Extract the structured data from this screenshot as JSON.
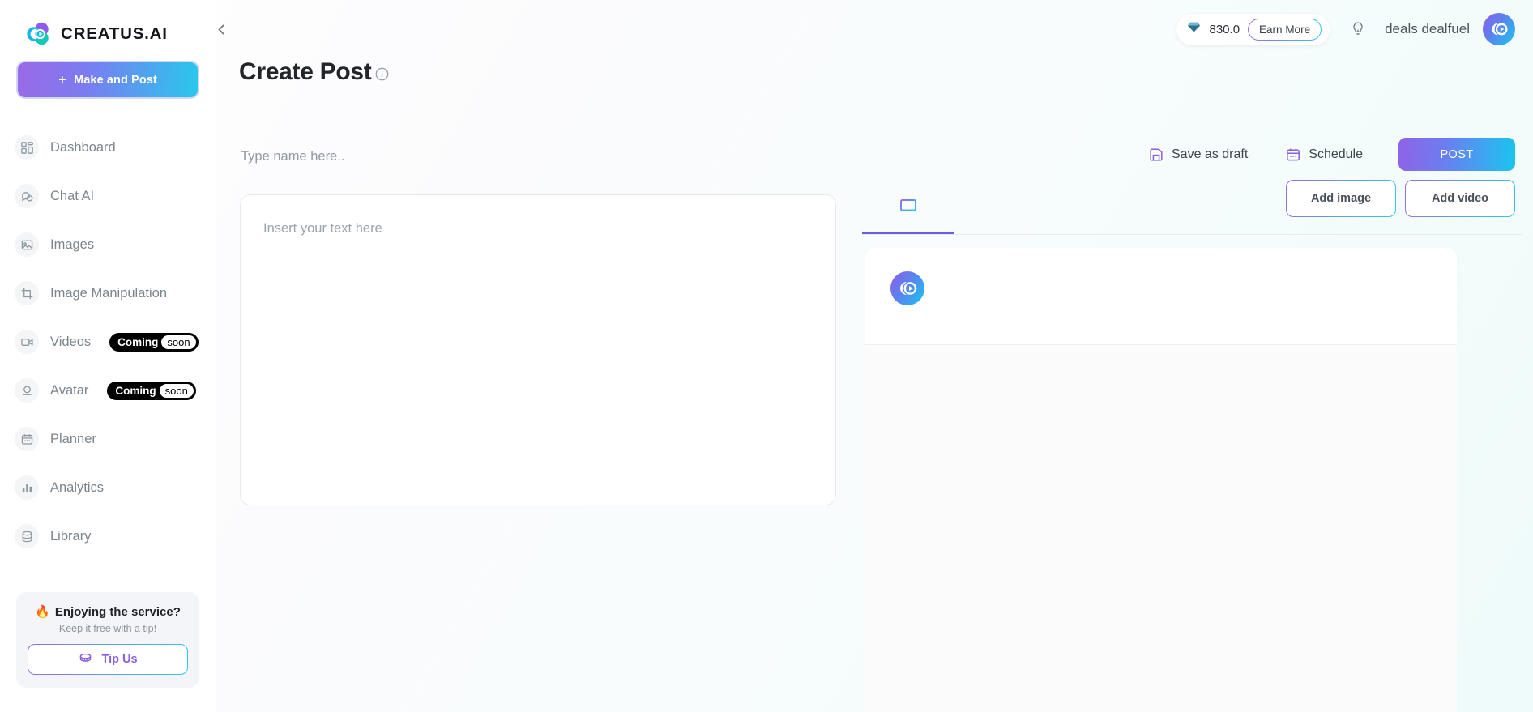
{
  "brand": {
    "name": "CREATUS.AI",
    "logo_icon": "creatus-logo-icon"
  },
  "sidebar": {
    "make_post_label": "Make and Post",
    "items": [
      {
        "label": "Dashboard",
        "icon": "dashboard-grid-icon",
        "badge": null
      },
      {
        "label": "Chat AI",
        "icon": "chat-bubbles-icon",
        "badge": null
      },
      {
        "label": "Images",
        "icon": "image-picture-icon",
        "badge": null
      },
      {
        "label": "Image Manipulation",
        "icon": "crop-icon",
        "badge": null
      },
      {
        "label": "Videos",
        "icon": "video-camera-icon",
        "badge": {
          "primary": "Coming",
          "secondary": "soon"
        }
      },
      {
        "label": "Avatar",
        "icon": "avatar-person-icon",
        "badge": {
          "primary": "Coming",
          "secondary": "soon"
        }
      },
      {
        "label": "Planner",
        "icon": "calendar-icon",
        "badge": null
      },
      {
        "label": "Analytics",
        "icon": "bar-chart-icon",
        "badge": null
      },
      {
        "label": "Library",
        "icon": "database-stack-icon",
        "badge": null
      }
    ],
    "tip_card": {
      "emoji": "🔥",
      "title": "Enjoying the service?",
      "subtitle": "Keep it free with a tip!",
      "button_label": "Tip Us",
      "button_icon": "coin-icon"
    }
  },
  "header": {
    "collapse_icon": "chevron-left-icon",
    "credits_icon": "gem-diamond-icon",
    "credits_value": "830.0",
    "earn_more_label": "Earn More",
    "bulb_icon": "lightbulb-icon",
    "username": "deals dealfuel",
    "avatar_icon": "user-avatar"
  },
  "page": {
    "title": "Create Post",
    "info_icon": "info-circle-icon"
  },
  "editor": {
    "name_placeholder": "Type name here..",
    "name_value": "",
    "body_placeholder": "Insert your text here",
    "body_value": ""
  },
  "toolbar": {
    "save_draft_label": "Save as draft",
    "save_draft_icon": "floppy-save-icon",
    "schedule_label": "Schedule",
    "schedule_icon": "calendar-icon",
    "post_label": "POST"
  },
  "preview": {
    "tabs": [
      {
        "label": "",
        "icon": "desktop-monitor-icon",
        "active": true
      }
    ],
    "add_image_label": "Add image",
    "add_video_label": "Add video",
    "avatar_icon": "creatus-avatar-icon"
  },
  "colors": {
    "accent_purple": "#8a5fe0",
    "accent_cyan": "#2ec9ec",
    "text_primary": "#22262b",
    "text_muted": "#7b858d",
    "sidebar_bg": "#ffffff"
  }
}
